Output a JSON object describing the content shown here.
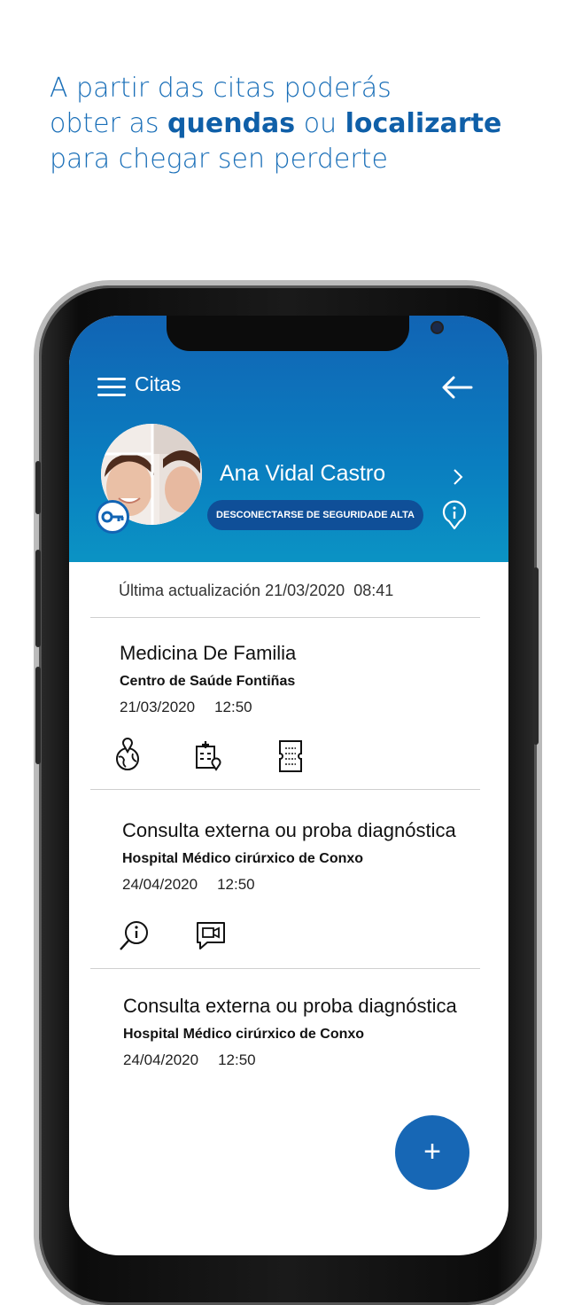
{
  "headline": {
    "line1": "A partir das citas poderás",
    "line2_pre": "obter as ",
    "line2_bold1": "quendas",
    "line2_mid": " ou ",
    "line2_bold2": "localizarte",
    "line3": "para chegar sen perderte"
  },
  "app": {
    "title": "Citas",
    "user_name": "Ana Vidal Castro",
    "logout_label": "DESCONECTARSE DE SEGURIDADE ALTA",
    "last_update_label": "Última actualización",
    "last_update_date": "21/03/2020",
    "last_update_time": "08:41",
    "fab_label": "+"
  },
  "appointments": [
    {
      "title_bold": "Medicina De Familia",
      "title_rest": "",
      "place": "Centro de Saúde Fontiñas",
      "date": "21/03/2020",
      "time": "12:50",
      "icons": [
        "map-pin-globe-icon",
        "hospital-location-icon",
        "ticket-icon"
      ]
    },
    {
      "title_bold": "Consulta externa",
      "title_rest": " ou proba diagnóstica",
      "place": "Hospital Médico cirúrxico de Conxo",
      "date": "24/04/2020",
      "time": "12:50",
      "icons": [
        "info-search-icon",
        "video-chat-icon"
      ]
    },
    {
      "title_bold": "Consulta externa",
      "title_rest": " ou proba diagnóstica",
      "place": "Hospital Médico cirúrxico de Conxo",
      "date": "24/04/2020",
      "time": "12:50",
      "icons": []
    }
  ],
  "colors": {
    "brand_blue": "#1164b4",
    "hero_end": "#0b93c4",
    "headline": "#1a6fb8",
    "fab": "#1767b5"
  }
}
